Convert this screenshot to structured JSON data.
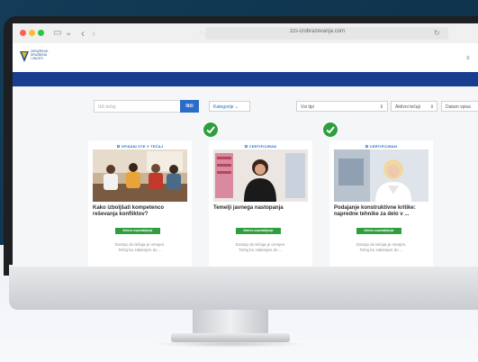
{
  "browser": {
    "url": "zzs-izobrazevanja.com",
    "back_icon": "chevron-left-icon",
    "forward_icon": "chevron-right-icon",
    "sidebar_icon": "sidebar-icon"
  },
  "site": {
    "logo_text": [
      "ZDRUŽENJE",
      "DRUŽBENA",
      "I ZNOSTI"
    ]
  },
  "filters": {
    "search_placeholder": "Išči tečaj",
    "search_button": "Išči",
    "category": "Kategorije",
    "type": "Vsi tipi",
    "active": "Aktivni tečaji",
    "date": "Datum vpisa"
  },
  "cards": [
    {
      "tag": "✪ VPISANI STE V TEČAJ",
      "title": "Kako izboljšati kompetenco reševanja konfliktov?",
      "badge": "Interno usposabljanje",
      "note1": "Dostop do tečaja je omejen.",
      "note2": "Tečaj bo zaklenjen do ..."
    },
    {
      "tag": "✪ CERTIFICIRAN",
      "title": "Temelji javnega nastopanja",
      "badge": "Interno usposabljanje",
      "note1": "Dostop do tečaja je omejen.",
      "note2": "Tečaj bo zaklenjen do ..."
    },
    {
      "tag": "✪ CERTIFICIRAN",
      "title": "Podajanje konstruktivne kritike: napredne tehnike za delo v ...",
      "badge": "Interno usposabljanje",
      "note1": "Dostop do tečaja je omejen.",
      "note2": "Tečaj bo zaklenjen do ..."
    }
  ],
  "colors": {
    "brand_blue": "#173e8f",
    "accent_blue": "#2b6cc9",
    "success_green": "#2f9e3e",
    "background_dark": "#123c58"
  }
}
